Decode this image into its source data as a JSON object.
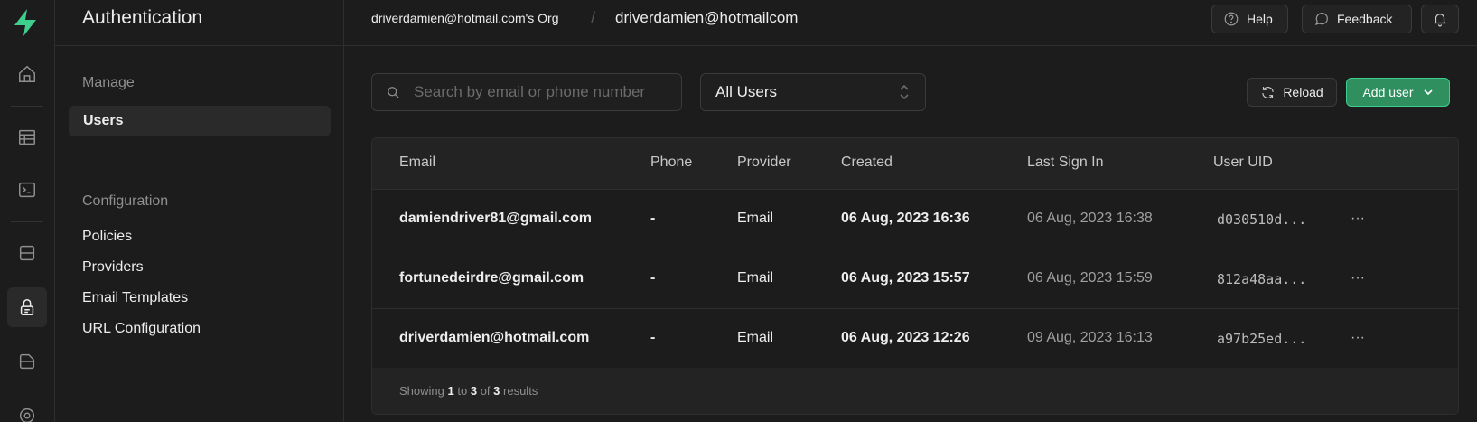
{
  "rail": {
    "icons": [
      "supabase-logo-icon",
      "home-icon",
      "table-editor-icon",
      "sql-editor-icon",
      "database-icon",
      "authentication-icon",
      "storage-icon",
      "edge-functions-icon"
    ],
    "accent": "#3ecf8e"
  },
  "sidebar": {
    "title": "Authentication",
    "manage_label": "Manage",
    "items_manage": [
      {
        "label": "Users",
        "active": true
      }
    ],
    "config_label": "Configuration",
    "items_config": [
      {
        "label": "Policies"
      },
      {
        "label": "Providers"
      },
      {
        "label": "Email Templates"
      },
      {
        "label": "URL Configuration"
      }
    ]
  },
  "header": {
    "org": "driverdamien@hotmail.com's Org",
    "separator": "/",
    "project": "driverdamien@hotmailcom",
    "help_label": "Help",
    "feedback_label": "Feedback"
  },
  "toolbar": {
    "search_placeholder": "Search by email or phone number",
    "filter_value": "All Users",
    "reload_label": "Reload",
    "add_user_label": "Add user"
  },
  "table": {
    "columns": [
      "Email",
      "Phone",
      "Provider",
      "Created",
      "Last Sign In",
      "User UID"
    ],
    "rows": [
      {
        "email": "damiendriver81@gmail.com",
        "phone": "-",
        "provider": "Email",
        "created": "06 Aug, 2023 16:36",
        "last_sign_in": "06 Aug, 2023 16:38",
        "uid": "d030510d..."
      },
      {
        "email": "fortunedeirdre@gmail.com",
        "phone": "-",
        "provider": "Email",
        "created": "06 Aug, 2023 15:57",
        "last_sign_in": "06 Aug, 2023 15:59",
        "uid": "812a48aa..."
      },
      {
        "email": "driverdamien@hotmail.com",
        "phone": "-",
        "provider": "Email",
        "created": "06 Aug, 2023 12:26",
        "last_sign_in": "09 Aug, 2023 16:13",
        "uid": "a97b25ed..."
      }
    ],
    "row_menu": "···",
    "footer": {
      "prefix": "Showing",
      "from": "1",
      "to_word": "to",
      "to": "3",
      "of_word": "of",
      "total": "3",
      "suffix": "results"
    }
  }
}
